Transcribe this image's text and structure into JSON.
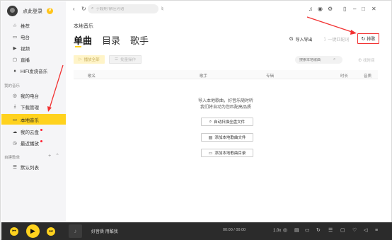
{
  "sidebar": {
    "login_label": "点此登录",
    "vip_badge": "V",
    "nav": [
      {
        "label": "推荐",
        "icon": "star-icon"
      },
      {
        "label": "电台",
        "icon": "radio-icon"
      },
      {
        "label": "视频",
        "icon": "video-icon"
      },
      {
        "label": "直播",
        "icon": "live-icon"
      },
      {
        "label": "HIFI发烧音乐",
        "icon": "hifi-icon"
      }
    ],
    "my_music_label": "我的音乐",
    "my_items": [
      {
        "label": "我的电台",
        "icon": "radio-icon"
      },
      {
        "label": "下载管理",
        "icon": "download-icon"
      },
      {
        "label": "本地音乐",
        "icon": "monitor-icon"
      },
      {
        "label": "我的云盘",
        "icon": "cloud-icon"
      },
      {
        "label": "最近播放",
        "icon": "clock-icon"
      }
    ],
    "playlist_section_label": "自建歌单",
    "playlist_items": [
      {
        "label": "默认列表",
        "icon": "list-icon"
      }
    ]
  },
  "topbar": {
    "search_placeholder": "于毅翔 徐佳河语"
  },
  "main": {
    "title": "本地音乐",
    "tabs": [
      "单曲",
      "目录",
      "歌手"
    ],
    "import_label": "导入导出",
    "match_label": "一键匹配词",
    "sort_label": "排歌",
    "play_all_label": "播放全部",
    "batch_label": "批量操作",
    "local_search_placeholder": "搜索本地歌曲",
    "find_label": "找时间",
    "columns": [
      "歌名",
      "歌手",
      "专辑",
      "时长",
      "音质"
    ],
    "empty_line1": "导入本地歌曲，好音乐随时听",
    "empty_line2": "我们将自动为您匹配高品质",
    "auto_scan_label": "自动扫描全盘文件",
    "add_file_label": "添加本地歌曲文件",
    "add_folder_label": "添加本地歌曲目录"
  },
  "player": {
    "song_title": "好音质 用酷我",
    "time": "00:00 / 00:00",
    "speed": "1.0x"
  },
  "colors": {
    "accent": "#ffd21e",
    "annotation": "#f23232",
    "player_bg": "#2b2b2b"
  }
}
